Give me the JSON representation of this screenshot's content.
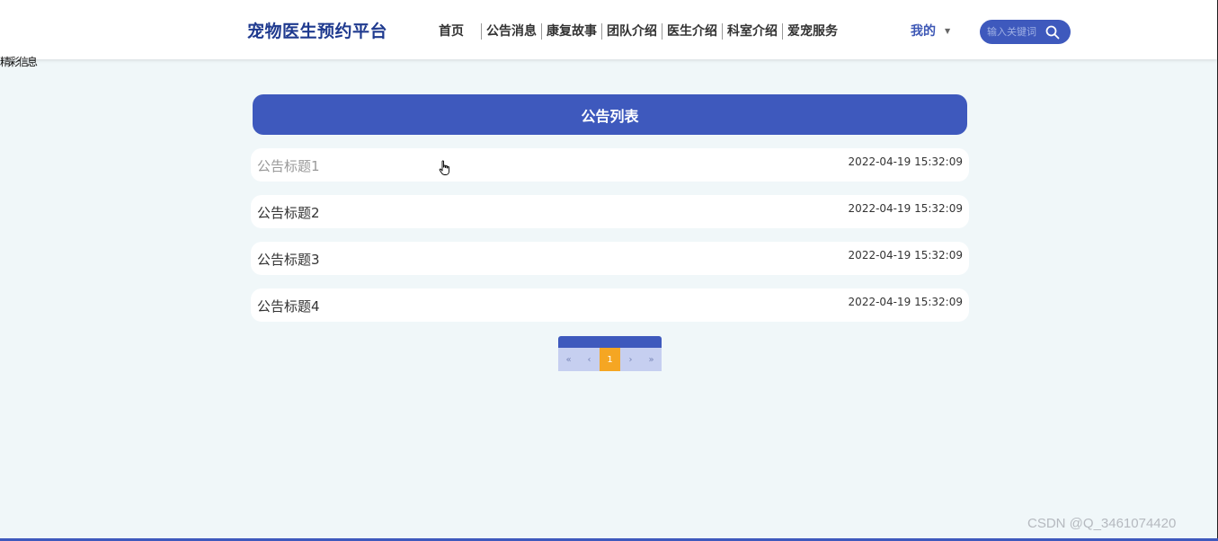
{
  "header": {
    "brand": "宠物医生预约平台",
    "nav": [
      "首页",
      "公告消息",
      "康复故事",
      "团队介绍",
      "医生介绍",
      "科室介绍",
      "爱宠服务"
    ],
    "mine_label": "我的",
    "search_placeholder": "输入关键词"
  },
  "stray_text": "精彩信息",
  "page_title": "公告列表",
  "notices": [
    {
      "title": "公告标题1",
      "time": "2022-04-19 15:32:09"
    },
    {
      "title": "公告标题2",
      "time": "2022-04-19 15:32:09"
    },
    {
      "title": "公告标题3",
      "time": "2022-04-19 15:32:09"
    },
    {
      "title": "公告标题4",
      "time": "2022-04-19 15:32:09"
    }
  ],
  "pagination": {
    "first": "«",
    "prev": "‹",
    "current": "1",
    "next": "›",
    "last": "»"
  },
  "watermark": "CSDN @Q_3461074420",
  "colors": {
    "primary": "#3e59bd",
    "brand": "#1f3a8f",
    "background": "#f0f7f9",
    "active_page": "#f5a623"
  }
}
